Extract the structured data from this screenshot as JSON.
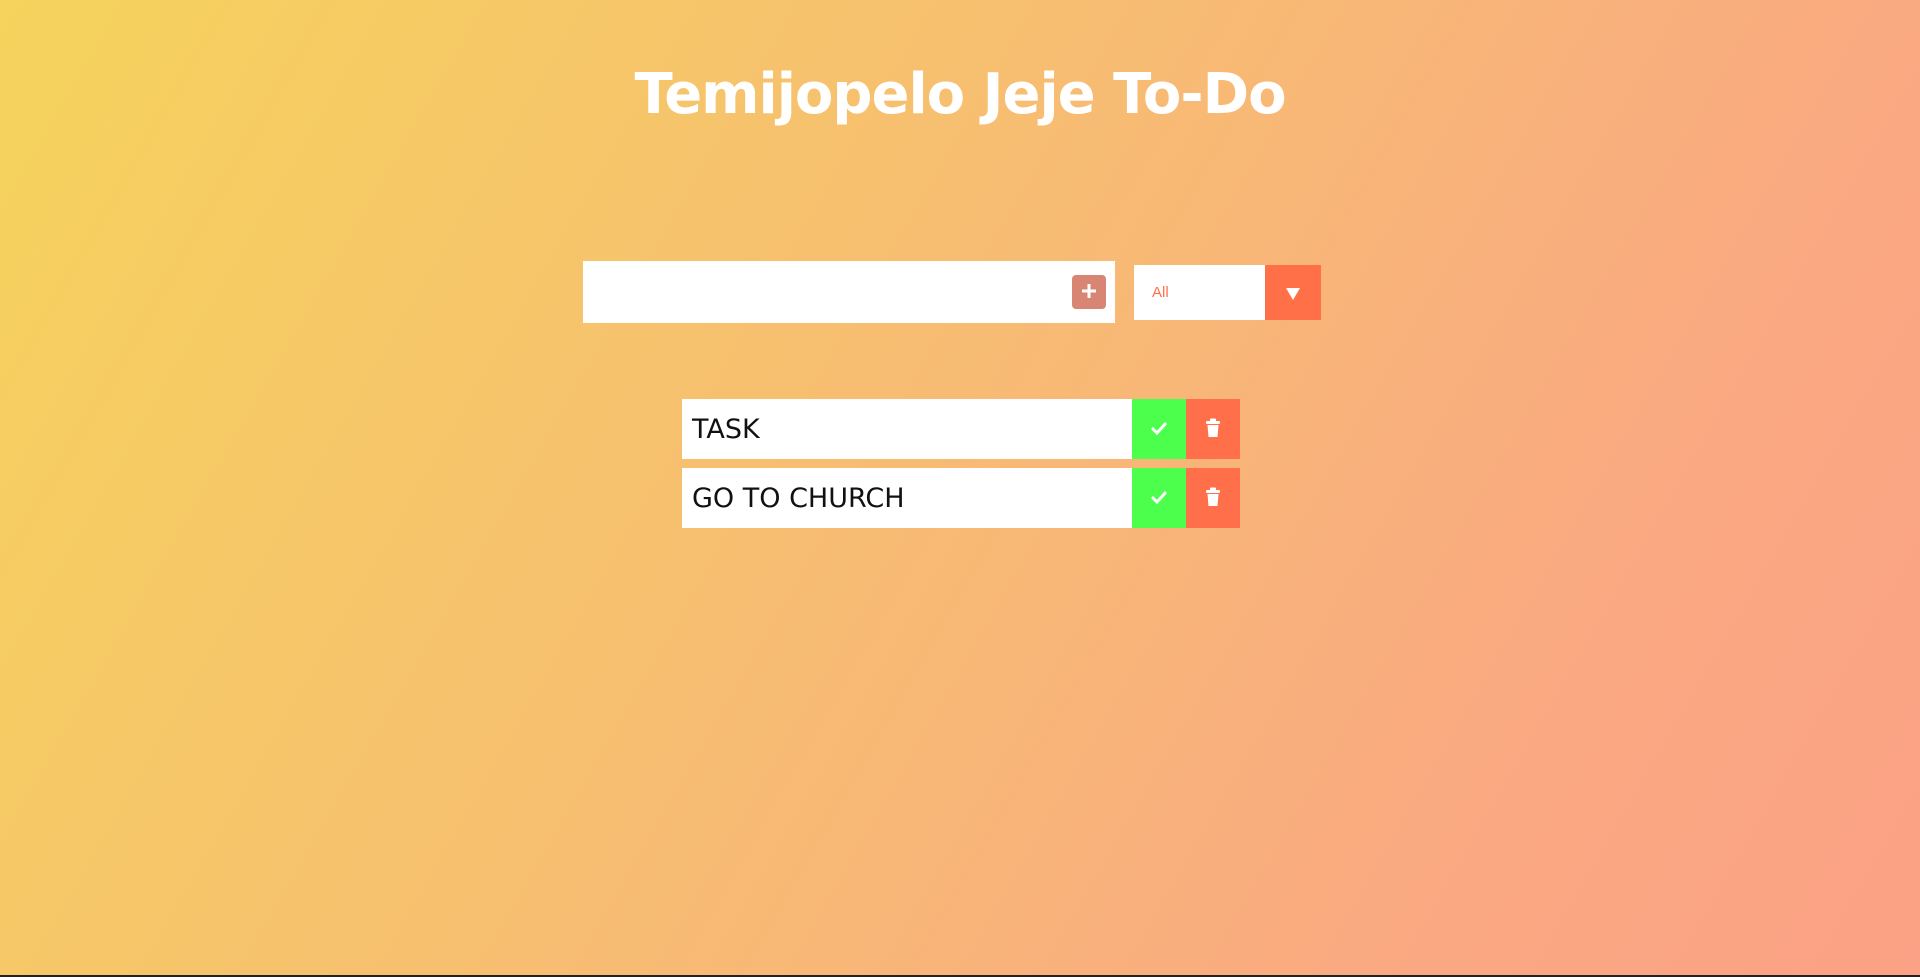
{
  "header": {
    "title": "Temijopelo Jeje To-Do"
  },
  "form": {
    "input_value": "",
    "input_placeholder": "",
    "add_icon": "plus-square-icon",
    "filter_selected": "All",
    "filter_arrow_icon": "triangle-down-icon"
  },
  "todos": [
    {
      "text": "TASK",
      "complete_icon": "check-icon",
      "delete_icon": "trash-icon"
    },
    {
      "text": "GO TO CHURCH",
      "complete_icon": "check-icon",
      "delete_icon": "trash-icon"
    }
  ],
  "colors": {
    "gradient_start": "#f5d35c",
    "gradient_end": "#fba185",
    "accent": "#ff704a",
    "complete": "#4cff4c",
    "add_button": "#d98573"
  }
}
